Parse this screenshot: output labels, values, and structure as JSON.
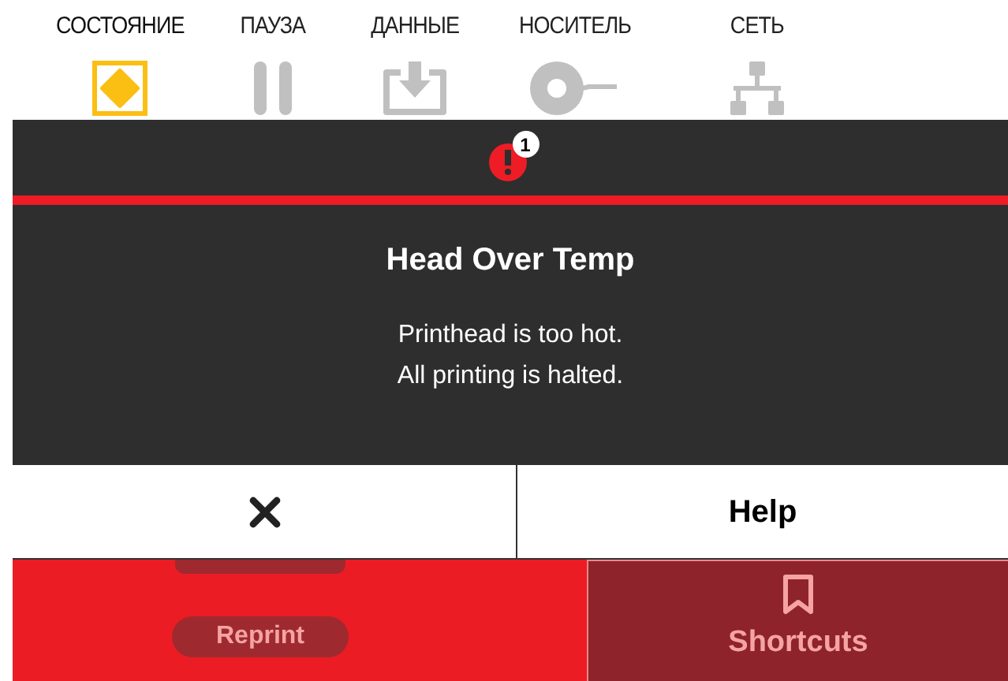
{
  "tabs": [
    {
      "label": "СОСТОЯНИЕ",
      "kind": "status",
      "selected": true
    },
    {
      "label": "ПАУЗА",
      "kind": "pause",
      "selected": false
    },
    {
      "label": "ДАННЫЕ",
      "kind": "data",
      "selected": false
    },
    {
      "label": "НОСИТЕЛЬ",
      "kind": "media",
      "selected": false
    },
    {
      "label": "СЕТЬ",
      "kind": "network",
      "selected": false
    }
  ],
  "alert": {
    "count": "1",
    "title": "Head Over Temp",
    "lines": [
      "Printhead is too hot.",
      "All printing is halted."
    ]
  },
  "actions": {
    "help": "Help"
  },
  "home": {
    "reprint": "Reprint",
    "shortcuts": "Shortcuts"
  }
}
